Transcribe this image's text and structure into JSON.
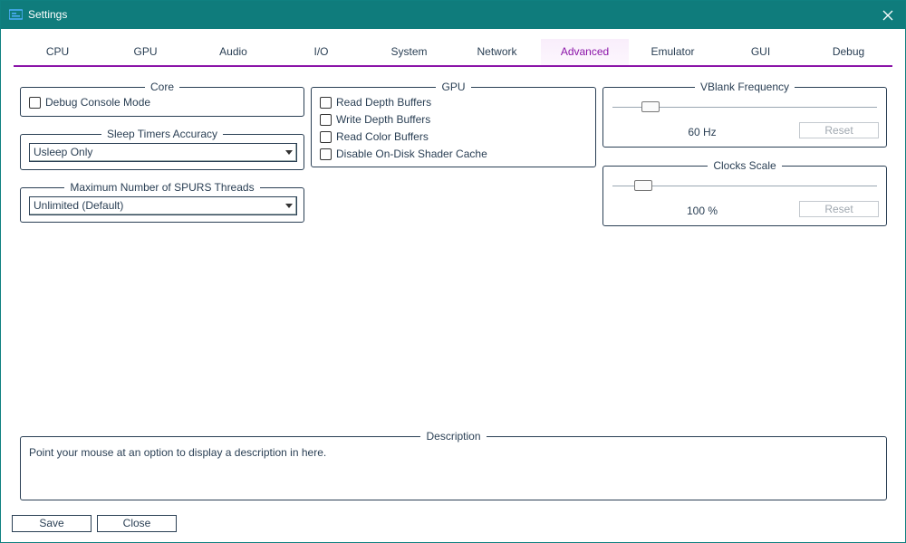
{
  "window": {
    "title": "Settings"
  },
  "tabs": [
    {
      "label": "CPU"
    },
    {
      "label": "GPU"
    },
    {
      "label": "Audio"
    },
    {
      "label": "I/O"
    },
    {
      "label": "System"
    },
    {
      "label": "Network"
    },
    {
      "label": "Advanced",
      "active": true
    },
    {
      "label": "Emulator"
    },
    {
      "label": "GUI"
    },
    {
      "label": "Debug"
    }
  ],
  "core": {
    "title": "Core",
    "debug_console_mode": {
      "label": "Debug Console Mode",
      "checked": false
    }
  },
  "sleep_timers": {
    "title": "Sleep Timers Accuracy",
    "selected": "Usleep Only"
  },
  "spurs": {
    "title": "Maximum Number of SPURS Threads",
    "selected": "Unlimited (Default)"
  },
  "gpu": {
    "title": "GPU",
    "options": [
      {
        "label": "Read Depth Buffers",
        "checked": false
      },
      {
        "label": "Write Depth Buffers",
        "checked": false
      },
      {
        "label": "Read Color Buffers",
        "checked": false
      },
      {
        "label": "Disable On-Disk Shader Cache",
        "checked": false
      }
    ]
  },
  "vblank": {
    "title": "VBlank Frequency",
    "value_text": "60 Hz",
    "reset_label": "Reset"
  },
  "clocks": {
    "title": "Clocks Scale",
    "value_text": "100 %",
    "reset_label": "Reset"
  },
  "description": {
    "title": "Description",
    "text": "Point your mouse at an option to display a description in here."
  },
  "footer": {
    "save_label": "Save",
    "close_label": "Close"
  },
  "colors": {
    "titlebar": "#0f7c7c",
    "accent": "#8b14a8",
    "text": "#2a3f54"
  }
}
